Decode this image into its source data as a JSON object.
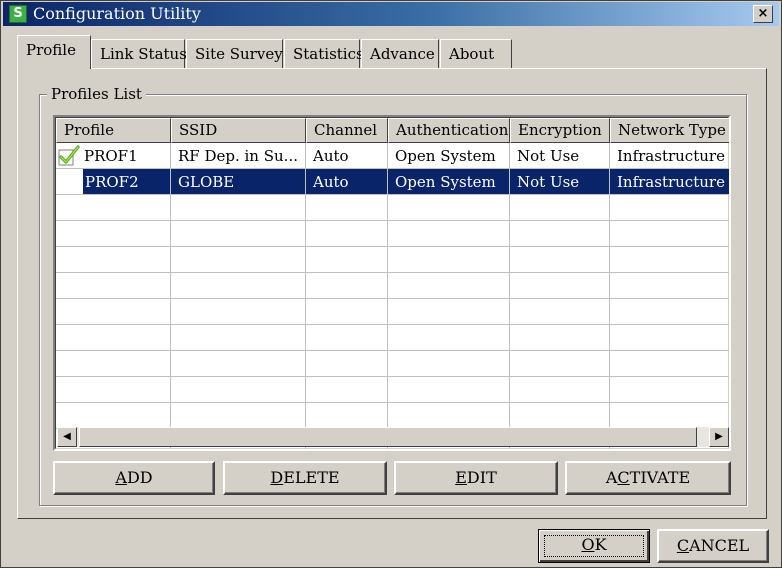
{
  "window": {
    "title": "Configuration Utility",
    "icon_letter": "S",
    "close_glyph": "×"
  },
  "tabs": [
    {
      "label": "Profile",
      "active": true
    },
    {
      "label": "Link Status",
      "active": false
    },
    {
      "label": "Site Survey",
      "active": false
    },
    {
      "label": "Statistics",
      "active": false
    },
    {
      "label": "Advance",
      "active": false
    },
    {
      "label": "About",
      "active": false
    }
  ],
  "profiles_list": {
    "group_label": "Profiles List",
    "columns": [
      "Profile",
      "SSID",
      "Channel",
      "Authentication",
      "Encryption",
      "Network Type"
    ],
    "rows": [
      {
        "profile": "PROF1",
        "ssid": "RF Dep. in Su...",
        "channel": "Auto",
        "authentication": "Open System",
        "encryption": "Not Use",
        "network_type": "Infrastructure",
        "active_icon": "checkmark-icon",
        "selected": false
      },
      {
        "profile": "PROF2",
        "ssid": "GLOBE",
        "channel": "Auto",
        "authentication": "Open System",
        "encryption": "Not Use",
        "network_type": "Infrastructure",
        "active_icon": "",
        "selected": true
      }
    ],
    "empty_row_count": 10
  },
  "actions": {
    "add": {
      "pre": "",
      "mnemonic": "A",
      "post": "DD"
    },
    "delete": {
      "pre": "",
      "mnemonic": "D",
      "post": "ELETE"
    },
    "edit": {
      "pre": "",
      "mnemonic": "E",
      "post": "DIT"
    },
    "activate": {
      "pre": "A",
      "mnemonic": "C",
      "post": "TIVATE"
    }
  },
  "dialog_buttons": {
    "ok": {
      "pre": "",
      "mnemonic": "O",
      "post": "K"
    },
    "cancel": {
      "pre": "",
      "mnemonic": "C",
      "post": "ANCEL"
    }
  },
  "colors": {
    "selection": "#0a246a",
    "titlebar_start": "#0a246a",
    "face": "#d4d0c8",
    "check": "#3cb043"
  }
}
